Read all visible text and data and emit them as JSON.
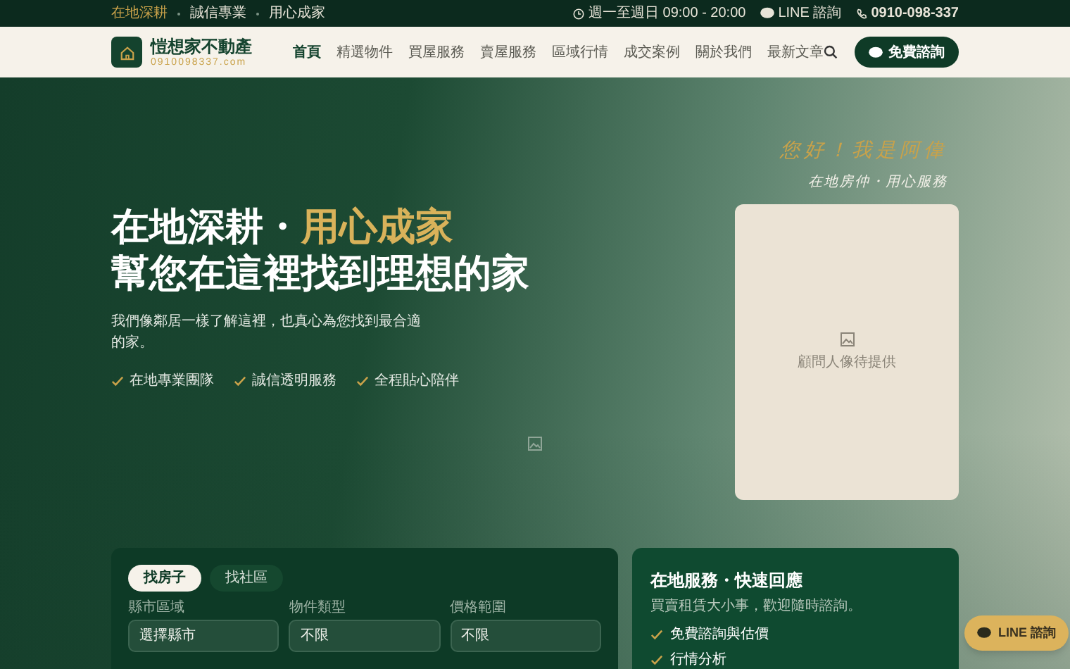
{
  "top_bar": {
    "taglines": [
      "在地深耕",
      "誠信專業",
      "用心成家"
    ],
    "hours": "週一至週日 09:00 - 20:00",
    "line": "LINE 諮詢",
    "phone": "0910-098-337"
  },
  "header": {
    "brand": "愷想家不動產",
    "domain": "0910098337.com",
    "nav": [
      {
        "label": "首頁",
        "selected": true
      },
      {
        "label": "精選物件",
        "selected": false
      },
      {
        "label": "買屋服務",
        "selected": false
      },
      {
        "label": "賣屋服務",
        "selected": false
      },
      {
        "label": "區域行情",
        "selected": false
      },
      {
        "label": "成交案例",
        "selected": false
      },
      {
        "label": "關於我們",
        "selected": false
      },
      {
        "label": "最新文章",
        "selected": false
      }
    ],
    "cta": "免費諮詢"
  },
  "hero": {
    "headline_part1": "在地深耕・",
    "headline_accent": "用心成家",
    "headline_line2": "幫您在這裡找到理想的家",
    "description": "我們像鄰居一樣了解這裡，也真心為您找到最合適的家。",
    "features": [
      "在地專業團隊",
      "誠信透明服務",
      "全程貼心陪伴"
    ],
    "greeting": "您好！我是阿偉",
    "greeting_sub": "在地房仲・用心服務",
    "portrait_caption": "顧問人像待提供"
  },
  "search": {
    "tabs": [
      {
        "label": "找房子",
        "selected": true
      },
      {
        "label": "找社區",
        "selected": false
      }
    ],
    "fields": [
      {
        "label": "縣市區域",
        "value": "選擇縣市"
      },
      {
        "label": "物件類型",
        "value": "不限"
      },
      {
        "label": "價格範圍",
        "value": "不限"
      }
    ]
  },
  "service_card": {
    "title": "在地服務・快速回應",
    "subtitle": "買賣租賃大小事，歡迎隨時諮詢。",
    "items": [
      "免費諮詢與估價",
      "行情分析"
    ]
  },
  "floating_line": "LINE 諮詢"
}
